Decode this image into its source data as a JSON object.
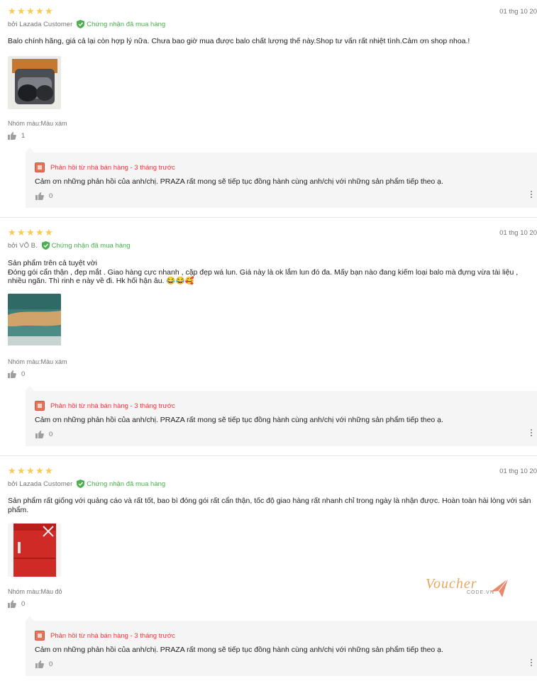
{
  "reviews": [
    {
      "rating": 5,
      "date": "01 thg 10 20",
      "author": "bởi Lazada Customer",
      "verified": "Chứng nhận đã mua hàng",
      "content": "Balo chính hãng, giá cả lại còn hợp lý nữa. Chưa bao giờ mua được balo chất lượng thế này.Shop tư vấn rất nhiệt tình.Cảm ơn shop nhoa.!",
      "variant": "Nhóm màu:Màu xám",
      "likes": "1",
      "reply": {
        "header": "Phản hồi từ nhà bán hàng - 3 tháng trước",
        "text": "Cảm ơn những phản hồi của anh/chị. PRAZA rất mong sẽ tiếp tục đồng hành cùng anh/chị với những sản phẩm tiếp theo ạ.",
        "likes": "0"
      }
    },
    {
      "rating": 5,
      "date": "01 thg 10 20",
      "author": "bởi VÕ B.",
      "verified": "Chứng nhận đã mua hàng",
      "content_lines": [
        "Sản phẩm trên cả tuyệt vời",
        "Đóng gói cẩn thận , đẹp mắt . Giao hàng cực nhanh , cặp đẹp wá lun. Giá này là ok lắm lun đó đa. Mấy bạn nào đang kiếm loại balo mà đựng vừa tài liệu , nhiều ngăn. Thì rinh e này về đi. Hk hối hận âu. 😂😂🥰"
      ],
      "variant": "Nhóm màu:Màu xám",
      "likes": "0",
      "reply": {
        "header": "Phản hồi từ nhà bán hàng - 3 tháng trước",
        "text": "Cảm ơn những phản hồi của anh/chị. PRAZA rất mong sẽ tiếp tục đồng hành cùng anh/chị với những sản phẩm tiếp theo ạ.",
        "likes": "0"
      }
    },
    {
      "rating": 5,
      "date": "01 thg 10 20",
      "author": "bởi Lazada Customer",
      "verified": "Chứng nhận đã mua hàng",
      "content": "Sản phẩm rất giống với quảng cáo và rất tốt, bao bì đóng gói rất cẩn thận, tốc độ giao hàng rất nhanh chỉ trong ngày là nhận được. Hoàn toàn hài lòng với sản phẩm.",
      "variant": "Nhóm màu:Màu đỏ",
      "likes": "0",
      "reply": {
        "header": "Phản hồi từ nhà bán hàng - 3 tháng trước",
        "text": "Cảm ơn những phản hồi của anh/chị. PRAZA rất mong sẽ tiếp tục đồng hành cùng anh/chị với những sản phẩm tiếp theo ạ.",
        "likes": "0"
      }
    }
  ],
  "watermark": {
    "brand": "Voucher",
    "sub": "CODE.VN"
  },
  "colors": {
    "star": "#faca51",
    "verified": "#4caf50",
    "reply_header": "#e53935",
    "reply_bg": "#f5f5f5"
  }
}
